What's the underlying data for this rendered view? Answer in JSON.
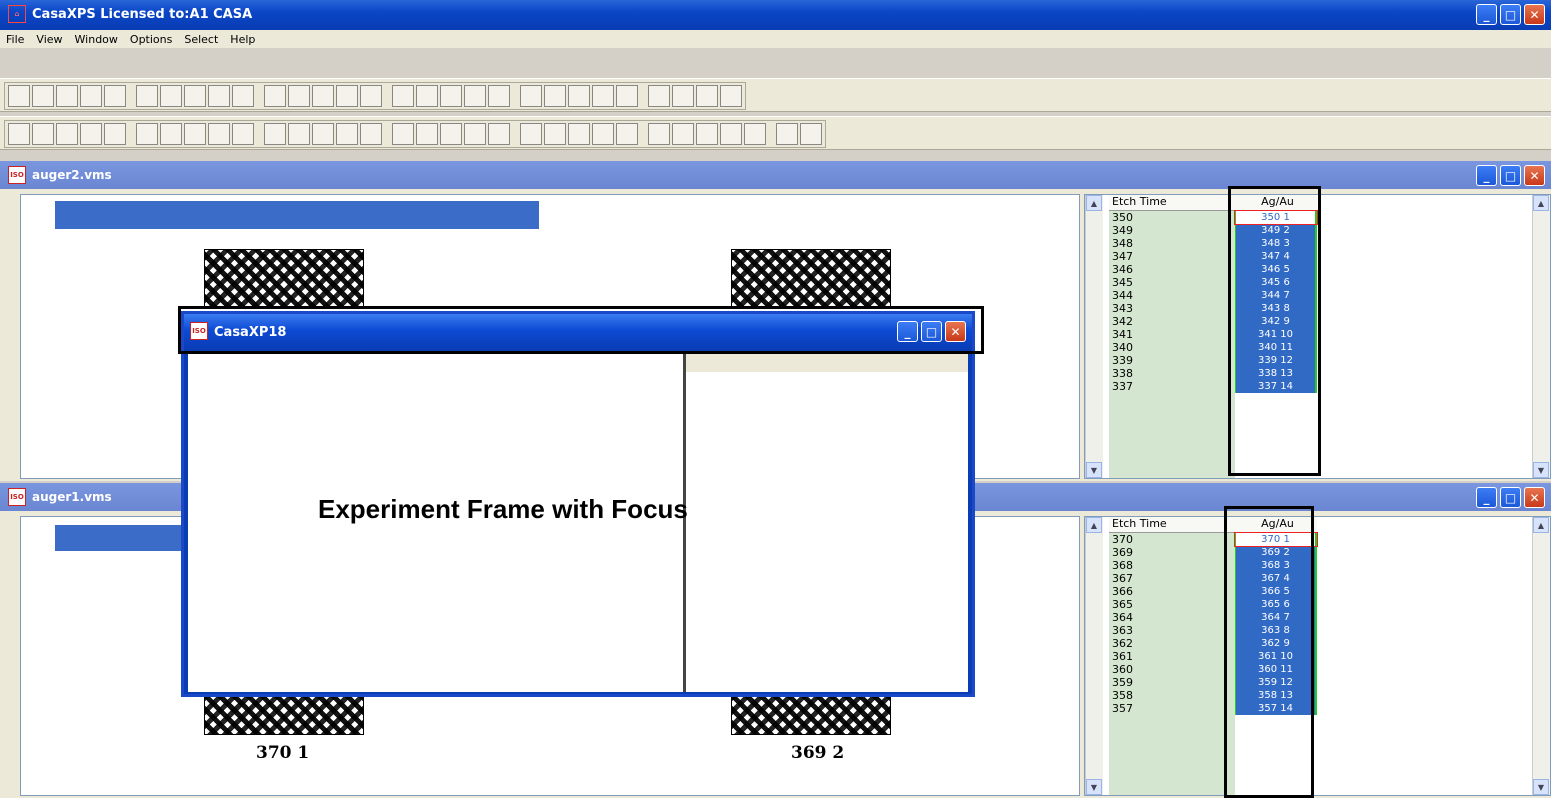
{
  "app": {
    "title": "CasaXPS Licensed to:A1 CASA"
  },
  "menu": [
    "File",
    "View",
    "Window",
    "Options",
    "Select",
    "Help"
  ],
  "toolbar1": [
    "new",
    "open",
    "open2",
    "save",
    "b1",
    "b2",
    "b3",
    "b4",
    "b5",
    "b6",
    "b7",
    "b8",
    "b9",
    "b10",
    "b11",
    "b12",
    "b13",
    "b14",
    "b15",
    "b16",
    "b17",
    "b18",
    "b19",
    "b20",
    "b21",
    "b22",
    "b23",
    "b24",
    "b25",
    "b26"
  ],
  "windows": {
    "auger2": {
      "title": "auger2.vms",
      "col_etch": "Etch Time",
      "col_ratio": "Ag/Au",
      "etch": [
        "350",
        "349",
        "348",
        "347",
        "346",
        "345",
        "344",
        "343",
        "342",
        "341",
        "340",
        "339",
        "338",
        "337"
      ],
      "ratio": [
        "350 1",
        "349 2",
        "348 3",
        "347 4",
        "346 5",
        "345 6",
        "344 7",
        "343 8",
        "342 9",
        "341 10",
        "340 11",
        "339 12",
        "338 13",
        "337 14"
      ]
    },
    "auger1": {
      "title": "auger1.vms",
      "col_etch": "Etch Time",
      "col_ratio": "Ag/Au",
      "etch": [
        "370",
        "369",
        "368",
        "367",
        "366",
        "365",
        "364",
        "363",
        "362",
        "361",
        "360",
        "359",
        "358",
        "357"
      ],
      "ratio": [
        "370 1",
        "369 2",
        "368 3",
        "367 4",
        "366 5",
        "365 6",
        "364 7",
        "363 8",
        "362 9",
        "361 10",
        "360 11",
        "359 12",
        "358 13",
        "357 14"
      ],
      "thumb1_label": "370 1",
      "thumb2_label": "369 2"
    },
    "float": {
      "title": "CasaXP18",
      "caption": "Experiment Frame with Focus"
    }
  }
}
